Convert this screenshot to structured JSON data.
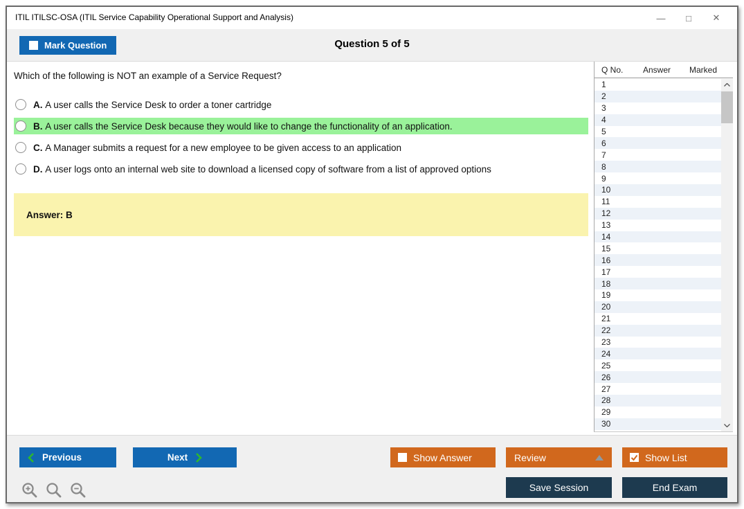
{
  "window": {
    "title": "ITIL ITILSC-OSA (ITIL Service Capability Operational Support and Analysis)"
  },
  "icons": {
    "minimize": "—",
    "maximize": "□",
    "close": "✕"
  },
  "toolbar": {
    "mark_question": "Mark Question",
    "question_counter": "Question 5 of 5"
  },
  "question": {
    "text": "Which of the following is NOT an example of a Service Request?",
    "options": [
      {
        "letter": "A.",
        "text": "A user calls the Service Desk to order a toner cartridge",
        "highlighted": false
      },
      {
        "letter": "B.",
        "text": "A user calls the Service Desk because they would like to change the functionality of an application.",
        "highlighted": true
      },
      {
        "letter": "C.",
        "text": "A Manager submits a request for a new employee to be given access to an application",
        "highlighted": false
      },
      {
        "letter": "D.",
        "text": "A user logs onto an internal web site to download a licensed copy of software from a list of approved options",
        "highlighted": false
      }
    ],
    "answer_label": "Answer: B"
  },
  "question_list": {
    "headers": [
      "Q No.",
      "Answer",
      "Marked"
    ],
    "rows": [
      {
        "q": "1",
        "answer": "",
        "marked": ""
      },
      {
        "q": "2",
        "answer": "",
        "marked": ""
      },
      {
        "q": "3",
        "answer": "",
        "marked": ""
      },
      {
        "q": "4",
        "answer": "",
        "marked": ""
      },
      {
        "q": "5",
        "answer": "",
        "marked": ""
      },
      {
        "q": "6",
        "answer": "",
        "marked": ""
      },
      {
        "q": "7",
        "answer": "",
        "marked": ""
      },
      {
        "q": "8",
        "answer": "",
        "marked": ""
      },
      {
        "q": "9",
        "answer": "",
        "marked": ""
      },
      {
        "q": "10",
        "answer": "",
        "marked": ""
      },
      {
        "q": "11",
        "answer": "",
        "marked": ""
      },
      {
        "q": "12",
        "answer": "",
        "marked": ""
      },
      {
        "q": "13",
        "answer": "",
        "marked": ""
      },
      {
        "q": "14",
        "answer": "",
        "marked": ""
      },
      {
        "q": "15",
        "answer": "",
        "marked": ""
      },
      {
        "q": "16",
        "answer": "",
        "marked": ""
      },
      {
        "q": "17",
        "answer": "",
        "marked": ""
      },
      {
        "q": "18",
        "answer": "",
        "marked": ""
      },
      {
        "q": "19",
        "answer": "",
        "marked": ""
      },
      {
        "q": "20",
        "answer": "",
        "marked": ""
      },
      {
        "q": "21",
        "answer": "",
        "marked": ""
      },
      {
        "q": "22",
        "answer": "",
        "marked": ""
      },
      {
        "q": "23",
        "answer": "",
        "marked": ""
      },
      {
        "q": "24",
        "answer": "",
        "marked": ""
      },
      {
        "q": "25",
        "answer": "",
        "marked": ""
      },
      {
        "q": "26",
        "answer": "",
        "marked": ""
      },
      {
        "q": "27",
        "answer": "",
        "marked": ""
      },
      {
        "q": "28",
        "answer": "",
        "marked": ""
      },
      {
        "q": "29",
        "answer": "",
        "marked": ""
      },
      {
        "q": "30",
        "answer": "",
        "marked": ""
      }
    ]
  },
  "footer": {
    "previous": "Previous",
    "next": "Next",
    "show_answer": "Show Answer",
    "review": "Review",
    "show_list": "Show List",
    "save_session": "Save Session",
    "end_exam": "End Exam"
  },
  "colors": {
    "primary_blue": "#1268b3",
    "accent_orange": "#d1681d",
    "dark_navy": "#1d3a4f",
    "highlight_green": "#9af29a",
    "answer_yellow": "#faf3ae",
    "row_alt_blue": "#edf2f8",
    "chevron_green": "#2eb82e",
    "toolbar_gray": "#f0f0f0"
  }
}
